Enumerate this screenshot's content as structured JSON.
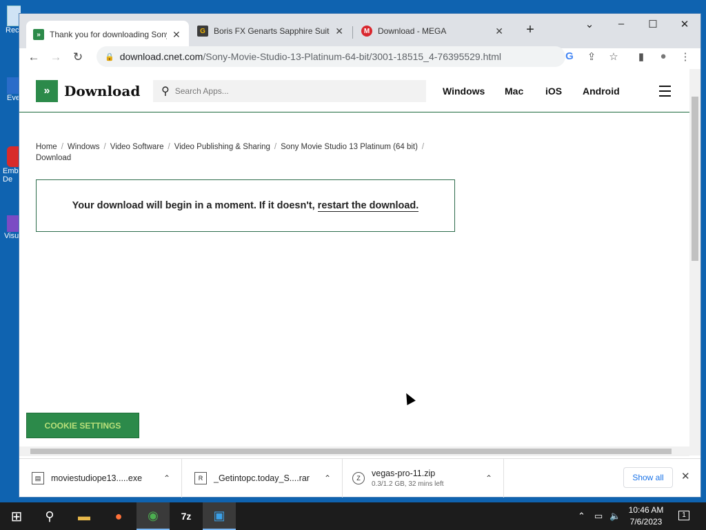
{
  "desktop": {
    "icons": [
      {
        "label": "Rec",
        "name": "recycle-bin-icon"
      },
      {
        "label": "Eve",
        "name": "eve-shortcut-icon"
      },
      {
        "label": "Emb\nDe",
        "name": "emb-shortcut-icon"
      },
      {
        "label": "Visu",
        "name": "visual-studio-shortcut-icon"
      }
    ]
  },
  "browser": {
    "tabs": [
      {
        "title": "Thank you for downloading Sony",
        "favicon": "cnet-favicon",
        "favicon_color": "#2c8a4a",
        "favicon_char": "»"
      },
      {
        "title": "Boris FX Genarts Sapphire Suite",
        "favicon": "getintopc-favicon",
        "favicon_color": "#3b3b3b",
        "favicon_char": "G"
      },
      {
        "title": "Download - MEGA",
        "favicon": "mega-favicon",
        "favicon_color": "#d9272e",
        "favicon_char": "M"
      }
    ],
    "new_tab": "+",
    "tab_search": "⌄",
    "win_controls": {
      "minimize": "–",
      "maximize": "☐",
      "close": "✕"
    },
    "nav": {
      "back": "←",
      "forward": "→",
      "reload": "↻"
    },
    "url": {
      "host": "download.cnet.com",
      "path": "/Sony-Movie-Studio-13-Platinum-64-bit/3001-18515_4-76395529.html"
    },
    "toolbar_icons": {
      "google": "G",
      "share": "⇪",
      "bookmark": "☆",
      "sidepanel": "▮",
      "profile": "●",
      "menu": "⋮"
    }
  },
  "site": {
    "logo_text": "Download",
    "logo_glyph": "»",
    "search_placeholder": "Search Apps...",
    "search_glyph": "⚲",
    "platform_nav": [
      "Windows",
      "Mac",
      "iOS",
      "Android"
    ],
    "breadcrumbs": [
      "Home",
      "Windows",
      "Video Software",
      "Video Publishing & Sharing",
      "Sony Movie Studio 13 Platinum (64 bit)",
      "Download"
    ],
    "breadcrumb_sep": "/",
    "download_message": "Your download will begin in a moment. If it doesn't,",
    "restart_link": "restart the download.",
    "cookie_button": "COOKIE SETTINGS"
  },
  "downloads": {
    "items": [
      {
        "filename": "moviestudiope13.....exe",
        "icon": "exe-file-icon",
        "status": ""
      },
      {
        "filename": "_Getintopc.today_S....rar",
        "icon": "rar-file-icon",
        "status": ""
      },
      {
        "filename": "vegas-pro-11.zip",
        "icon": "zip-file-icon",
        "status": "0.3/1.2 GB, 32 mins left"
      }
    ],
    "show_all": "Show all",
    "close": "✕",
    "chevron": "⌃"
  },
  "taskbar": {
    "start": "⊞",
    "search": "⚲",
    "apps": [
      {
        "name": "file-explorer-icon",
        "glyph": "▬",
        "color": "#e8b84a"
      },
      {
        "name": "firefox-icon",
        "glyph": "●",
        "color": "#ff7139"
      },
      {
        "name": "chrome-icon",
        "glyph": "◉",
        "color": "#4caf50"
      },
      {
        "name": "7zip-icon",
        "glyph": "7z",
        "color": "#ffffff"
      },
      {
        "name": "video-editor-icon",
        "glyph": "▣",
        "color": "#3aa0e8"
      }
    ],
    "tray": {
      "chevron": "⌃",
      "network": "▭",
      "volume": "🔈"
    },
    "time": "10:46 AM",
    "date": "7/6/2023",
    "notifications": "1"
  }
}
